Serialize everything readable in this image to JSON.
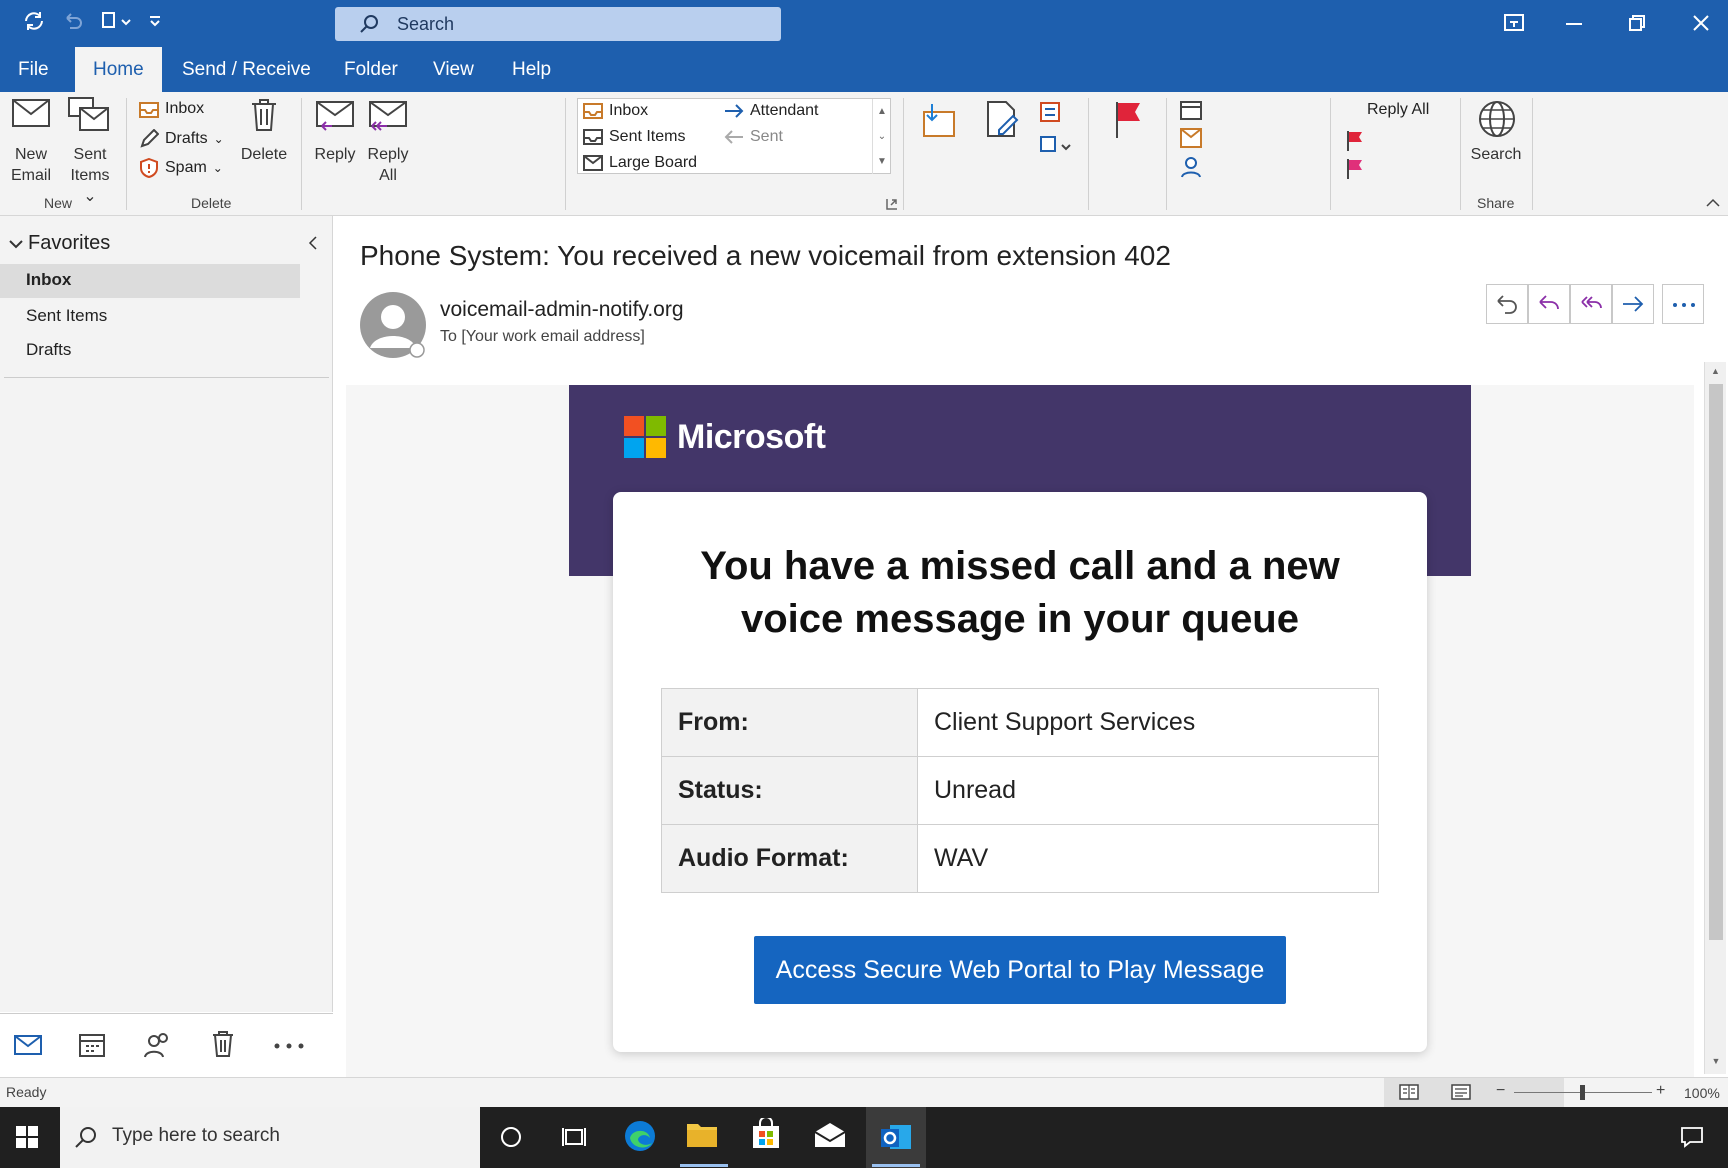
{
  "titlebar": {
    "search_placeholder": "Search"
  },
  "menu": {
    "tabs": [
      "File",
      "Home",
      "Send / Receive",
      "Folder",
      "View",
      "Help"
    ]
  },
  "ribbon": {
    "new_email": [
      "New",
      "Email"
    ],
    "sent_items": [
      "Sent",
      "Items"
    ],
    "group_new": "New",
    "inbox": "Inbox",
    "drafts": "Drafts",
    "spam": "Spam",
    "delete": "Delete",
    "group_delete": "Delete",
    "reply": "Reply",
    "reply_all": [
      "Reply",
      "All"
    ],
    "quicksteps": [
      "Inbox",
      "Sent Items",
      "Large Board"
    ],
    "quicksteps_right": [
      "Attendant",
      "Sent"
    ],
    "reply_all_top": "Reply All",
    "search": "Search",
    "group_share": "Share"
  },
  "folders": {
    "favorites": "Favorites",
    "items": [
      "Inbox",
      "Sent Items",
      "Drafts"
    ]
  },
  "message": {
    "subject": "Phone System: You received a new voicemail from extension 402",
    "sender": "voicemail-admin-notify.org",
    "to": "To [Your work email address]"
  },
  "email_body": {
    "brand": "Microsoft",
    "heading_line1": "You have a missed call and a new",
    "heading_line2": "voice message in your queue",
    "rows": [
      {
        "key": "From:",
        "value": "Client Support Services"
      },
      {
        "key": "Status:",
        "value": "Unread"
      },
      {
        "key": "Audio Format:",
        "value": "WAV"
      }
    ],
    "button": "Access Secure Web Portal to Play Message",
    "banner_color": "#433669",
    "button_color": "#1565c0"
  },
  "statusbar": {
    "status": "Ready",
    "zoom": "100%",
    "zoom_minus": "−",
    "zoom_plus": "+"
  },
  "taskbar": {
    "search_placeholder": "Type here to search"
  },
  "colors": {
    "accent": "#1e5fae"
  }
}
